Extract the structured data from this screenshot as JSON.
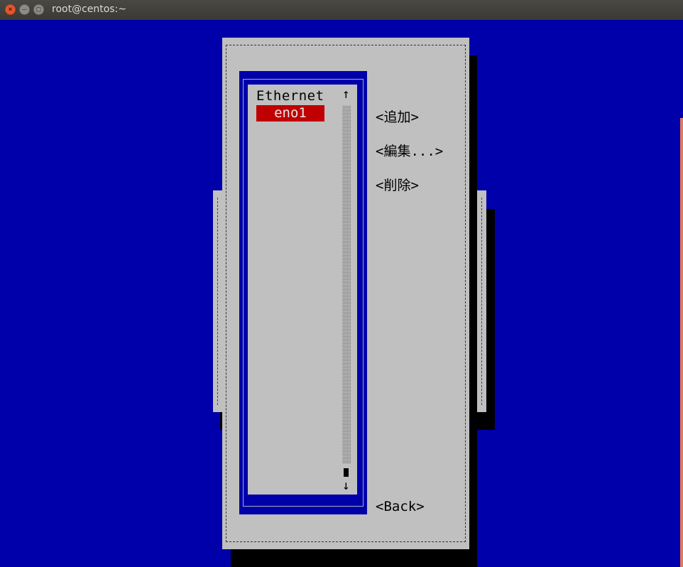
{
  "window": {
    "title": "root@centos:~",
    "close_glyph": "×",
    "minimize_glyph": "–",
    "maximize_glyph": "□"
  },
  "connection_list": {
    "header": "Ethernet",
    "items": [
      "eno1"
    ],
    "selected": "eno1",
    "scroll_up_arrow": "↑",
    "scroll_down_arrow": "↓"
  },
  "actions": {
    "add": "<追加>",
    "edit": "<編集...>",
    "delete": "<削除>",
    "back": "<Back>"
  },
  "colors": {
    "terminal_bg": "#0000aa",
    "dialog_bg": "#c0c0c0",
    "selection_bg": "#c00000",
    "selection_fg": "#e8e8e8"
  }
}
